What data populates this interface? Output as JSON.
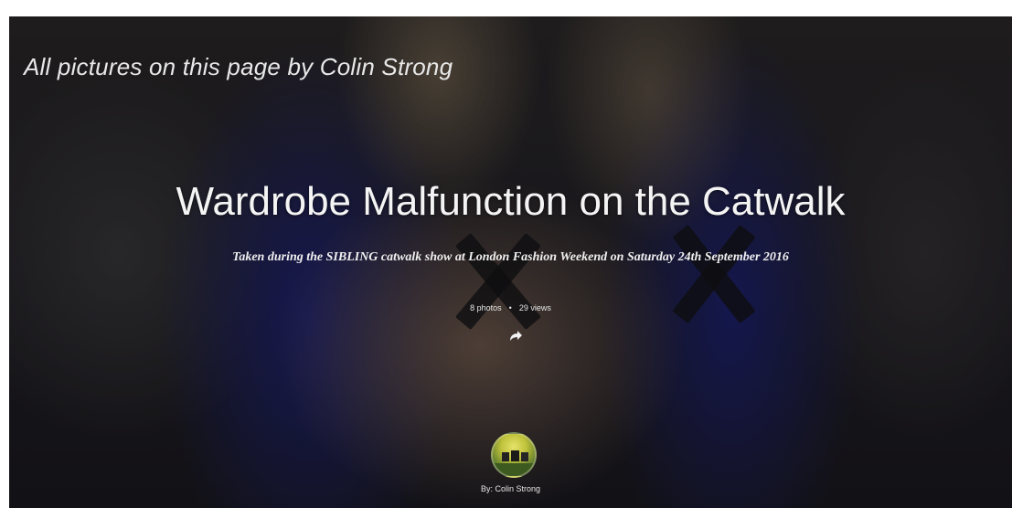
{
  "credit_text": "All pictures on this page by Colin Strong",
  "album": {
    "title": "Wardrobe Malfunction on the Catwalk",
    "subtitle": "Taken during the SIBLING catwalk show at London Fashion Weekend on Saturday 24th September 2016",
    "photos": "8 photos",
    "separator": "•",
    "views": "29 views",
    "share_icon": "share-arrow-icon"
  },
  "owner": {
    "avatar_icon": "owner-avatar",
    "byline": "By: Colin Strong"
  },
  "colors": {
    "text": "#f4f4f4",
    "background": "#1b1a1e"
  }
}
